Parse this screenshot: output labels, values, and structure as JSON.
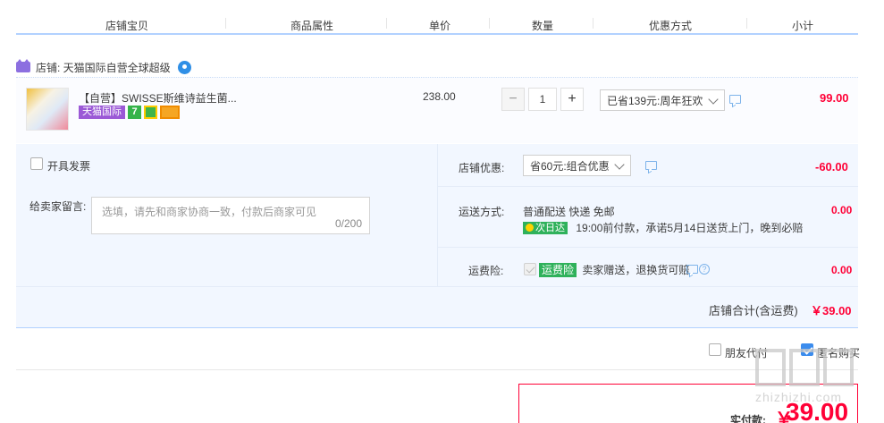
{
  "header": {
    "col_shop_item": "店铺宝贝",
    "col_attrs": "商品属性",
    "col_unit_price": "单价",
    "col_qty": "数量",
    "col_discount": "优惠方式",
    "col_subtotal": "小计"
  },
  "shop": {
    "label": "店铺: 天猫国际自营全球超级",
    "wangwang_icon": "wangwang-chat-icon"
  },
  "item": {
    "title": "【自营】SWISSE斯维诗益生菌...",
    "tag_tmall_global": "天猫国际",
    "tag_icons": [
      "seven-day-return-icon",
      "guarantee-icon",
      "card-icon"
    ],
    "unit_price": "238.00",
    "qty_minus": "−",
    "qty_value": "1",
    "qty_plus": "+",
    "discount_select": "已省139元:周年狂欢",
    "subtotal": "99.00"
  },
  "extras": {
    "invoice_label": "开具发票",
    "memo_label": "给卖家留言:",
    "memo_placeholder": "选填，请先和商家协商一致，付款后商家可见",
    "memo_counter": "0/200",
    "shop_discount_label": "店铺优惠:",
    "shop_discount_select": "省60元:组合优惠",
    "shop_discount_amount": "-60.00",
    "shipping_label": "运送方式:",
    "shipping_method": "普通配送 快递 免邮",
    "next_day_badge": "次日达",
    "shipping_detail": "19:00前付款，承诺5月14日送货上门，晚到必赔",
    "shipping_fee": "0.00",
    "insurance_label": "运费险:",
    "insurance_badge": "运费险",
    "insurance_text": "卖家赠送，退换货可赔",
    "insurance_fee": "0.00"
  },
  "shop_total": {
    "label": "店铺合计(含运费)",
    "amount": "￥39.00"
  },
  "options": {
    "friend_pay": "朋友代付",
    "anonymous_buy": "匿名购买",
    "anonymous_checked": true
  },
  "payment": {
    "label": "实付款:",
    "currency": "￥",
    "amount": "39.00"
  },
  "watermark": {
    "url": "zhizhizhi.com"
  },
  "colors": {
    "accent_red": "#ff0036",
    "accent_blue": "#3b8ced",
    "section_bg": "#f2f7ff",
    "badge_green": "#2fb15b",
    "tmall_purple": "#9b59d6"
  }
}
